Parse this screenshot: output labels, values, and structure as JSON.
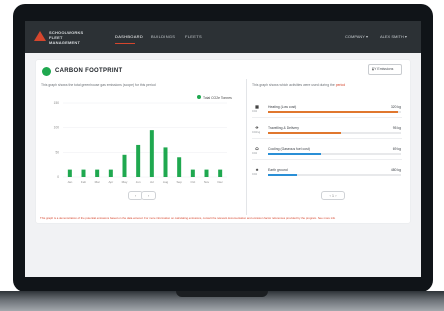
{
  "app": {
    "logo_text": "SCHOOLWORKS\nFLEET MANAGEMENT",
    "nav": [
      "DASHBOARD",
      "BUILDINGS",
      "FLEETS"
    ],
    "active_nav": 0,
    "top_right": [
      "COMPANY",
      "ALEX SMITH"
    ]
  },
  "page": {
    "title": "CARBON FOOTPRINT",
    "period_select": "FY Emissions"
  },
  "left_panel": {
    "description": "This graph shows the total greenhouse gas emissions (scope) for this period",
    "legend_label": "Total CO2e Tonnes",
    "pager_prev": "‹",
    "pager_next": "›"
  },
  "chart_data": {
    "type": "bar",
    "categories": [
      "Jan",
      "Feb",
      "Mar",
      "Apr",
      "May",
      "Jun",
      "Jul",
      "Aug",
      "Sep",
      "Oct",
      "Nov",
      "Dec"
    ],
    "series": [
      {
        "name": "Total CO2e Tonnes",
        "values": [
          15,
          15,
          15,
          15,
          45,
          65,
          95,
          60,
          40,
          15,
          15,
          15
        ]
      }
    ],
    "ylim": [
      0,
      150
    ],
    "yticks": [
      150,
      100,
      50,
      0
    ],
    "grid": true,
    "legend": "top-right",
    "colors": {
      "bar": "#1fa84f"
    }
  },
  "right_panel": {
    "description": "This graph shows which activities were used during the ",
    "description_link": "period",
    "items": [
      {
        "icon": "building-icon",
        "glyph": "▦",
        "sub": "CO2",
        "label": "Heating (Low cost)",
        "value": "320 kg",
        "fraction": 0.98,
        "color": "#e0772e"
      },
      {
        "icon": "plane-icon",
        "glyph": "✈",
        "sub": "CO2 kg",
        "label": "Travelling & Delivery",
        "value": "95 kg",
        "fraction": 0.55,
        "color": "#e0772e"
      },
      {
        "icon": "car-icon",
        "glyph": "⬭",
        "sub": "CO2",
        "label": "Cooling (Gaseous fuel cost)",
        "value": "69 kg",
        "fraction": 0.4,
        "color": "#2a8fd6"
      },
      {
        "icon": "tree-icon",
        "glyph": "♣",
        "sub": "CO2",
        "label": "Earth ground",
        "value": "480 kg",
        "fraction": 0.22,
        "color": "#2a8fd6"
      }
    ],
    "pager": "‹ 1 ›"
  },
  "footnote": "This graph is a demonstration of the potential emissions based on the data entered. For more information on calculating emissions, consult the relevant documentation and emission factor references provided by the program. See more info"
}
